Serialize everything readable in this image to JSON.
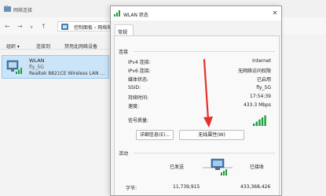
{
  "explorer": {
    "window_title": "网络连接",
    "address_path": "控制面板 › 网络和 Internet ›",
    "toolbar": {
      "organize": "组织 ▾",
      "connect_to": "连接到",
      "disable_device": "禁用此网络设备"
    },
    "adapter": {
      "name": "WLAN",
      "network": "fly_5G",
      "device": "Realtek 8821CE Wireless LAN ..."
    }
  },
  "dialog": {
    "title": "WLAN 状态",
    "tab": "常规",
    "connection_section": "连接",
    "rows": [
      {
        "label": "IPv4 连接:",
        "value": "Internet"
      },
      {
        "label": "IPv6 连接:",
        "value": "无网络访问权限"
      },
      {
        "label": "媒体状态:",
        "value": "已启用"
      },
      {
        "label": "SSID:",
        "value": "fly_5G"
      },
      {
        "label": "持续时间:",
        "value": "17:54:39"
      },
      {
        "label": "速度:",
        "value": "433.3 Mbps"
      }
    ],
    "signal_label": "信号质量:",
    "signal_bars": 5,
    "details_button": "详细信息(E)...",
    "wireless_props_button": "无线属性(W)",
    "activity_section": "活动",
    "sent_label": "已发送",
    "received_label": "已接收",
    "bytes_label": "字节:",
    "bytes_sent": "11,739,915",
    "bytes_received": "433,368,426"
  },
  "colors": {
    "signal_green": "#1e9e3e",
    "arrow_red": "#e5312c"
  }
}
